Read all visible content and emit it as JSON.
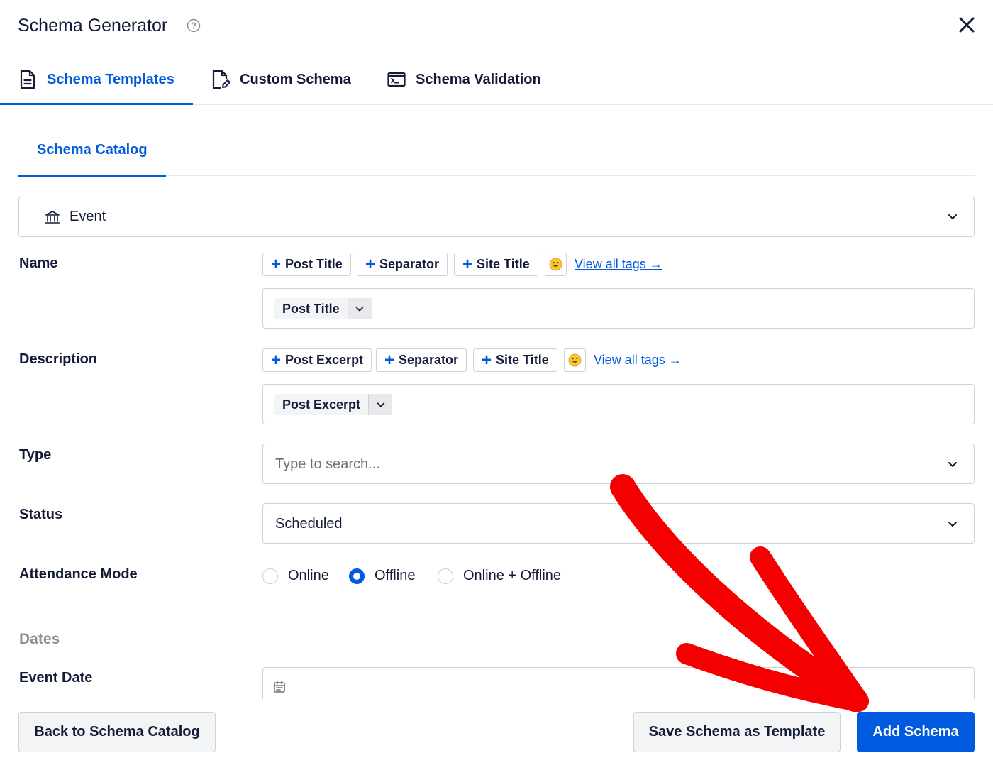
{
  "header": {
    "title": "Schema Generator",
    "help_icon": "question-circle-icon",
    "close_icon": "close-icon"
  },
  "tabs": [
    {
      "label": "Schema Templates",
      "icon": "document-icon",
      "active": true
    },
    {
      "label": "Custom Schema",
      "icon": "document-edit-icon",
      "active": false
    },
    {
      "label": "Schema Validation",
      "icon": "terminal-icon",
      "active": false
    }
  ],
  "subtabs": [
    {
      "label": "Schema Catalog",
      "active": true
    }
  ],
  "schema_select": {
    "value": "Event",
    "icon": "building-icon"
  },
  "fields": {
    "name": {
      "label": "Name",
      "tags": [
        "Post Title",
        "Separator",
        "Site Title"
      ],
      "view_all": "View all tags →",
      "value_tag": "Post Title"
    },
    "description": {
      "label": "Description",
      "tags": [
        "Post Excerpt",
        "Separator",
        "Site Title"
      ],
      "view_all": "View all tags →",
      "value_tag": "Post Excerpt"
    },
    "type": {
      "label": "Type",
      "placeholder": "Type to search..."
    },
    "status": {
      "label": "Status",
      "value": "Scheduled"
    },
    "attendance": {
      "label": "Attendance Mode",
      "options": [
        "Online",
        "Offline",
        "Online + Offline"
      ],
      "selected": "Offline"
    }
  },
  "dates": {
    "section_label": "Dates",
    "event_date_label": "Event Date",
    "icon": "calendar-icon"
  },
  "footer": {
    "back_label": "Back to Schema Catalog",
    "save_template_label": "Save Schema as Template",
    "add_label": "Add Schema"
  },
  "colors": {
    "accent": "#005ae0",
    "annotation": "#ff0000",
    "text": "#141b38"
  }
}
